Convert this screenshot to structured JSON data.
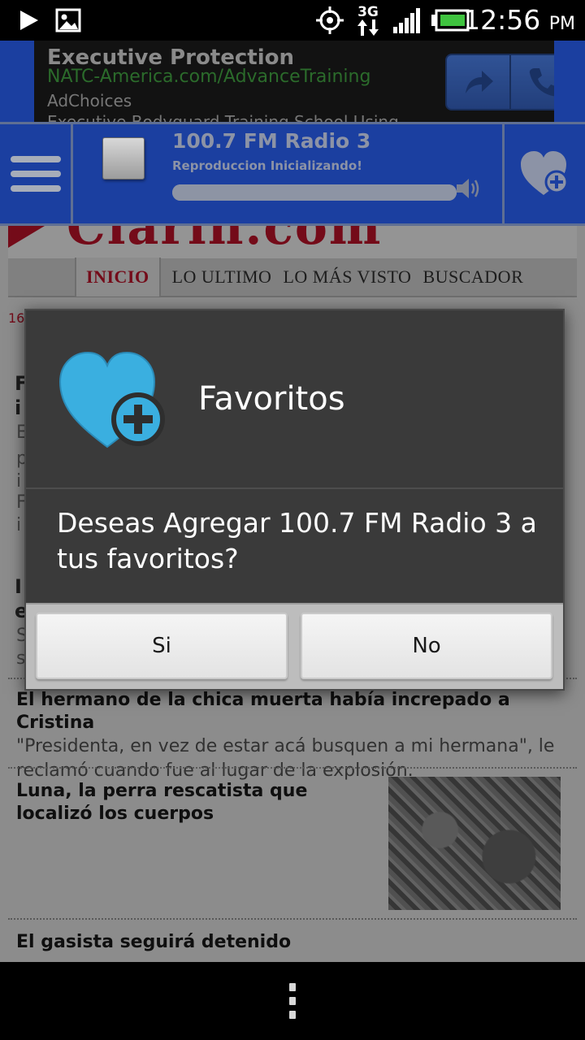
{
  "status_bar": {
    "time": "12:56",
    "ampm": "PM",
    "network": "3G",
    "icons": [
      "play-icon",
      "image-icon",
      "gps-icon",
      "3g-data-icon",
      "signal-icon",
      "battery-icon"
    ]
  },
  "ad": {
    "title": "Executive Protection",
    "url": "NATC-America.com/AdvanceTraining",
    "choices": "AdChoices",
    "more": "Executive Bodyguard Training School Using",
    "buttons": [
      "share-icon",
      "phone-icon"
    ]
  },
  "radio": {
    "station": "100.7 FM Radio 3",
    "status": "Reproduccion Inicializando!",
    "progress": 1.0
  },
  "website": {
    "logo": "Clarin.com",
    "nav": [
      "INICIO",
      "LO ULTIMO",
      "LO MÁS VISTO",
      "BUSCADOR"
    ],
    "date_fragment": "16",
    "left_fragments_bold": [
      "F",
      "i",
      "I",
      "e"
    ],
    "left_fragments_grey": [
      "E",
      "p",
      "i",
      "F",
      "i",
      "S",
      "s"
    ],
    "articles": [
      {
        "title": "El hermano de la chica muerta había increpado a Cristina",
        "summary": "\"Presidenta, en vez de estar acá busquen a mi hermana\", le reclamó cuando fue al lugar de la explosión."
      },
      {
        "title": "Luna, la perra rescatista que localizó los cuerpos",
        "summary": ""
      },
      {
        "title": "El gasista seguirá detenido",
        "summary": ""
      }
    ]
  },
  "dialog": {
    "title": "Favoritos",
    "message": "Deseas Agregar 100.7 FM Radio 3 a tus favoritos?",
    "yes_label": "Si",
    "no_label": "No"
  },
  "colors": {
    "radio_bar_blue": "#1b3fa0",
    "heart_blue": "#3aafe0",
    "clarin_red": "#c8142c",
    "dialog_bg": "#3a3a3a"
  }
}
